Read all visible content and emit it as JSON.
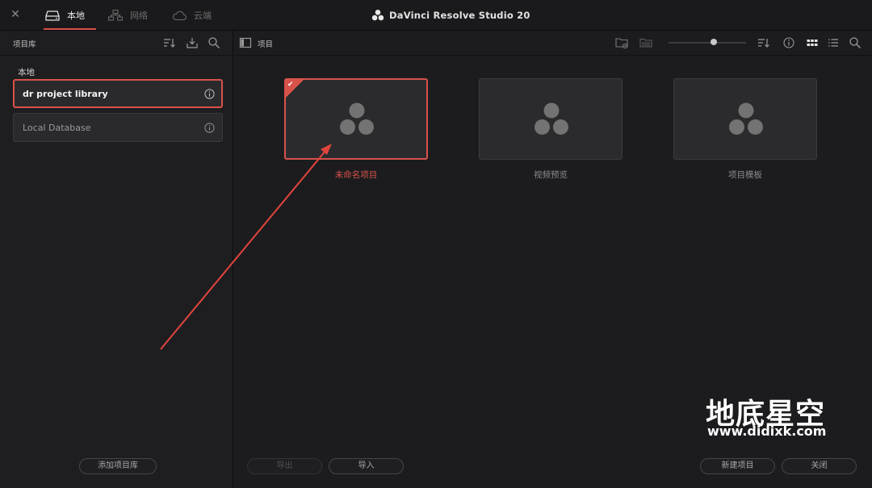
{
  "window": {
    "close_glyph": "✕",
    "title": "DaVinci Resolve Studio 20",
    "tabs": [
      {
        "label": "本地",
        "icon": "local-drive-icon",
        "active": true
      },
      {
        "label": "网络",
        "icon": "network-icon",
        "active": false
      },
      {
        "label": "云端",
        "icon": "cloud-icon",
        "active": false
      }
    ]
  },
  "sidebar": {
    "header": "项目库",
    "group_label": "本地",
    "libraries": [
      {
        "name": "dr project library",
        "selected": true
      },
      {
        "name": "Local Database",
        "selected": false
      }
    ],
    "add_button": "添加项目库"
  },
  "main": {
    "header": "项目",
    "projects": [
      {
        "name": "未命名项目",
        "selected": true
      },
      {
        "name": "视频预览",
        "selected": false
      },
      {
        "name": "项目模板",
        "selected": false
      }
    ],
    "buttons": {
      "export": "导出",
      "import": "导入",
      "new_project": "新建项目",
      "close": "关闭"
    }
  },
  "watermark": {
    "title": "地底星空",
    "url": "www.didixk.com"
  },
  "colors": {
    "accent": "#d9524a",
    "background": "#1c1c1f"
  }
}
